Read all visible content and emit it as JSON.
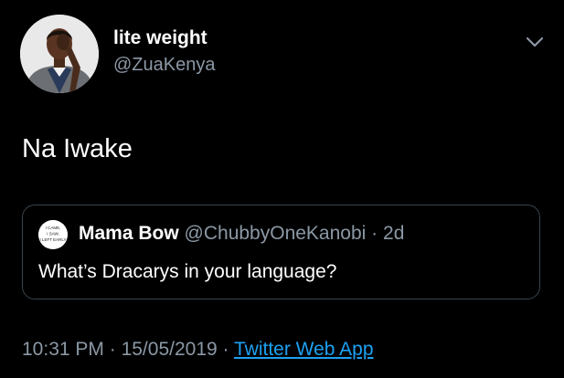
{
  "author": {
    "display_name": "lite weight",
    "handle": "@ZuaKenya"
  },
  "tweet": {
    "text": "Na Iwake"
  },
  "quoted_tweet": {
    "display_name": "Mama Bow",
    "handle": "@ChubbyOneKanobi",
    "separator": "·",
    "age": "2d",
    "text": "What’s Dracarys in your language?",
    "avatar_text": "I CAME, I SAW, I LEFT EARLY"
  },
  "meta": {
    "time": "10:31 PM",
    "separator_1": "·",
    "date": "15/05/2019",
    "separator_2": "·",
    "source": "Twitter Web App"
  },
  "icons": {
    "menu": "chevron-down-icon"
  },
  "colors": {
    "background": "#000000",
    "primary_text": "#ffffff",
    "secondary_text": "#8b98a5",
    "link": "#1da1f2",
    "card_border": "#38444d"
  }
}
